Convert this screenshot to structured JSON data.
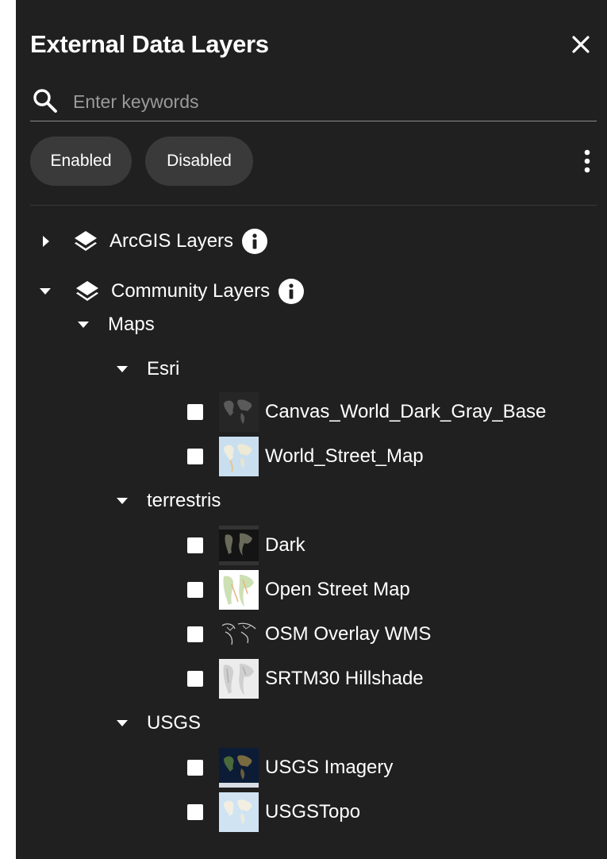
{
  "panel": {
    "title": "External Data Layers",
    "close_icon": "close-icon"
  },
  "search": {
    "placeholder": "Enter keywords",
    "value": "",
    "icon": "search-icon"
  },
  "filters": {
    "enabled_label": "Enabled",
    "disabled_label": "Disabled",
    "more_icon": "more-vert-icon"
  },
  "tree": {
    "arcgis": {
      "label": "ArcGIS Layers",
      "expanded": false
    },
    "community": {
      "label": "Community Layers",
      "expanded": true,
      "maps": {
        "label": "Maps",
        "expanded": true,
        "groups": [
          {
            "label": "Esri",
            "expanded": true,
            "layers": [
              {
                "label": "Canvas_World_Dark_Gray_Base",
                "checked": false,
                "thumbnail": "dark-gray-world-thumbnail"
              },
              {
                "label": "World_Street_Map",
                "checked": false,
                "thumbnail": "street-map-thumbnail"
              }
            ]
          },
          {
            "label": "terrestris",
            "expanded": true,
            "layers": [
              {
                "label": "Dark",
                "checked": false,
                "thumbnail": "dark-map-thumbnail"
              },
              {
                "label": "Open Street Map",
                "checked": false,
                "thumbnail": "osm-thumbnail"
              },
              {
                "label": "OSM Overlay WMS",
                "checked": false,
                "thumbnail": "osm-overlay-thumbnail"
              },
              {
                "label": "SRTM30 Hillshade",
                "checked": false,
                "thumbnail": "hillshade-thumbnail"
              }
            ]
          },
          {
            "label": "USGS",
            "expanded": true,
            "layers": [
              {
                "label": "USGS Imagery",
                "checked": false,
                "thumbnail": "imagery-thumbnail"
              },
              {
                "label": "USGSTopo",
                "checked": false,
                "thumbnail": "topo-thumbnail"
              }
            ]
          }
        ]
      }
    }
  },
  "colors": {
    "panel_bg": "#202020",
    "chip_bg": "#3a3a3a",
    "text": "#ffffff",
    "placeholder": "#9a9a9a"
  }
}
